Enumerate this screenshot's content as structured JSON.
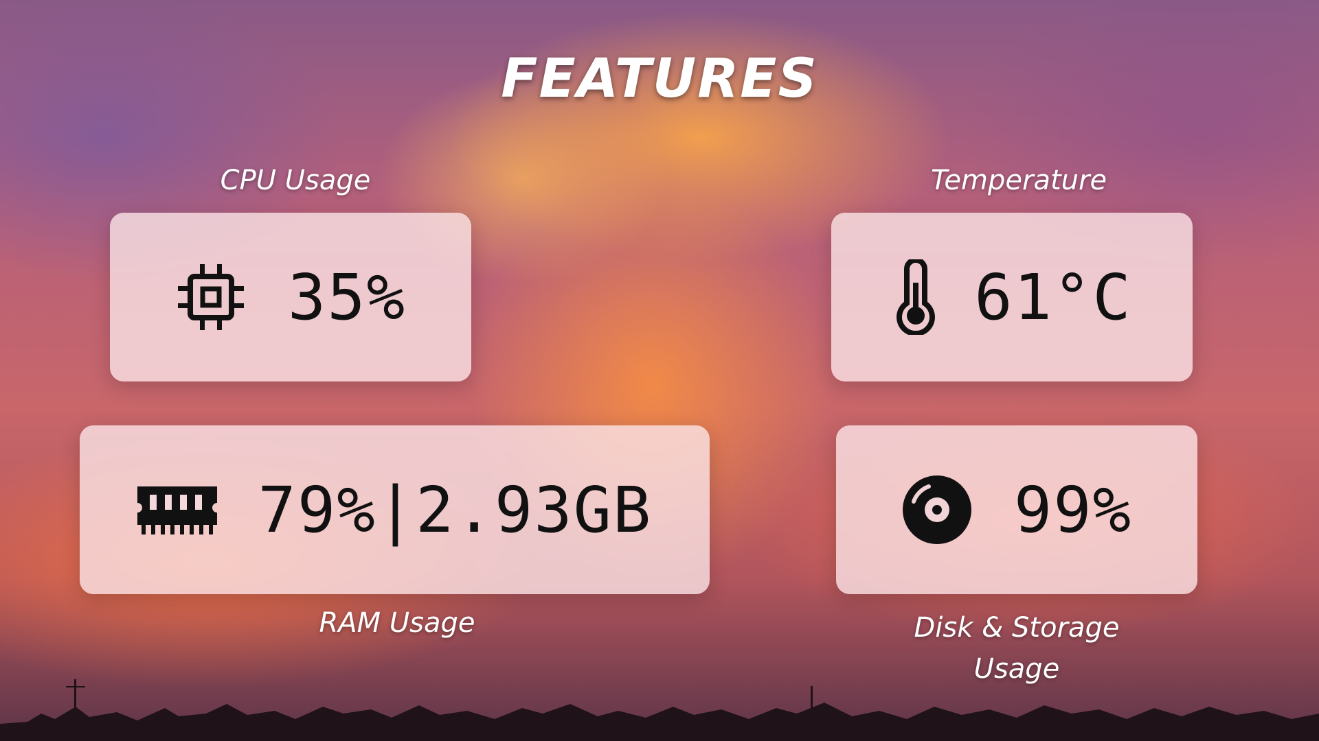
{
  "title": "FEATURES",
  "cards": {
    "cpu": {
      "label": "CPU Usage",
      "value": "35%",
      "icon": "cpu-chip-icon"
    },
    "temperature": {
      "label": "Temperature",
      "value": "61°C",
      "icon": "thermometer-icon"
    },
    "ram": {
      "label": "RAM Usage",
      "value": "79%|2.93GB",
      "icon": "memory-module-icon"
    },
    "disk": {
      "label": "Disk & Storage Usage",
      "value": "99%",
      "icon": "disk-icon"
    }
  },
  "colors": {
    "card_background": "#fae4e6",
    "value_text": "#111111",
    "label_text": "#ffffff"
  }
}
